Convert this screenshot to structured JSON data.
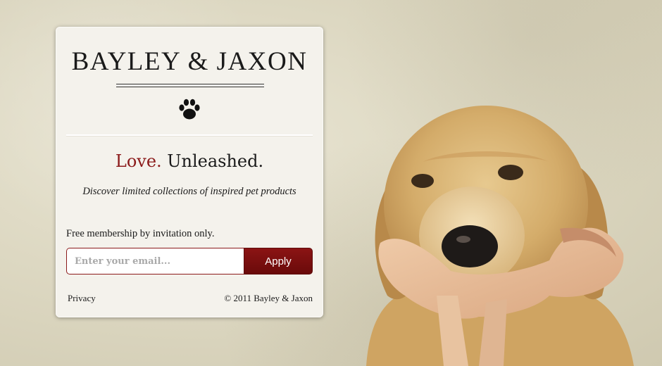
{
  "brand": {
    "name": "BAYLEY & JAXON"
  },
  "tagline": {
    "accent": "Love.",
    "rest": " Unleashed."
  },
  "subtitle": "Discover limited collections of inspired pet products",
  "signup": {
    "membership_text": "Free membership by invitation only.",
    "email_placeholder": "Enter your email...",
    "apply_label": "Apply"
  },
  "footer": {
    "privacy_label": "Privacy",
    "copyright": "© 2011 Bayley & Jaxon"
  },
  "icons": {
    "logo_mark": "paw-icon"
  },
  "colors": {
    "accent": "#8b1a1a",
    "button": "#7a0f0f",
    "card_bg": "#f4f2ec",
    "background": "#ddd8c2"
  },
  "background_image": "golden-retriever-with-ballet-slipper"
}
